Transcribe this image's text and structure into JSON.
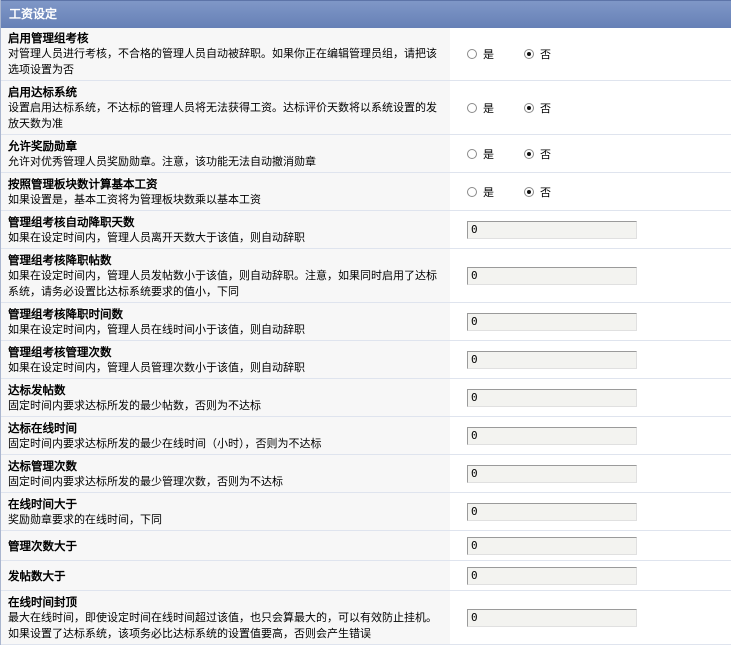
{
  "panel": {
    "title": "工资设定"
  },
  "radio_labels": {
    "yes": "是",
    "no": "否"
  },
  "rows": [
    {
      "title": "启用管理组考核",
      "desc": "对管理人员进行考核，不合格的管理人员自动被辞职。如果你正在编辑管理员组，请把该选项设置为否",
      "type": "radio",
      "selected": "否"
    },
    {
      "title": "启用达标系统",
      "desc": "设置启用达标系统，不达标的管理人员将无法获得工资。达标评价天数将以系统设置的发放天数为准",
      "type": "radio",
      "selected": "否"
    },
    {
      "title": "允许奖励勋章",
      "desc": "允许对优秀管理人员奖励勋章。注意，该功能无法自动撤消勋章",
      "type": "radio",
      "selected": "否"
    },
    {
      "title": "按照管理板块数计算基本工资",
      "desc": "如果设置是，基本工资将为管理板块数乘以基本工资",
      "type": "radio",
      "selected": "否"
    },
    {
      "title": "管理组考核自动降职天数",
      "desc": "如果在设定时间内，管理人员离开天数大于该值，则自动辞职",
      "type": "text",
      "value": "0"
    },
    {
      "title": "管理组考核降职帖数",
      "desc": "如果在设定时间内，管理人员发帖数小于该值，则自动辞职。注意，如果同时启用了达标系统，请务必设置比达标系统要求的值小，下同",
      "type": "text",
      "value": "0"
    },
    {
      "title": "管理组考核降职时间数",
      "desc": "如果在设定时间内，管理人员在线时间小于该值，则自动辞职",
      "type": "text",
      "value": "0"
    },
    {
      "title": "管理组考核管理次数",
      "desc": "如果在设定时间内，管理人员管理次数小于该值，则自动辞职",
      "type": "text",
      "value": "0"
    },
    {
      "title": "达标发帖数",
      "desc": "固定时间内要求达标所发的最少帖数，否则为不达标",
      "type": "text",
      "value": "0"
    },
    {
      "title": "达标在线时间",
      "desc": "固定时间内要求达标所发的最少在线时间（小时），否则为不达标",
      "type": "text",
      "value": "0"
    },
    {
      "title": "达标管理次数",
      "desc": "固定时间内要求达标所发的最少管理次数，否则为不达标",
      "type": "text",
      "value": "0"
    },
    {
      "title": "在线时间大于",
      "desc": "奖励勋章要求的在线时间，下同",
      "type": "text",
      "value": "0"
    },
    {
      "title": "管理次数大于",
      "desc": "",
      "type": "text",
      "value": "0"
    },
    {
      "title": "发帖数大于",
      "desc": "",
      "type": "text",
      "value": "0"
    },
    {
      "title": "在线时间封顶",
      "desc": "最大在线时间，即使设定时间在线时间超过该值，也只会算最大的，可以有效防止挂机。如果设置了达标系统，该项务必比达标系统的设置值要高，否则会产生错误",
      "type": "text",
      "value": "0"
    }
  ]
}
